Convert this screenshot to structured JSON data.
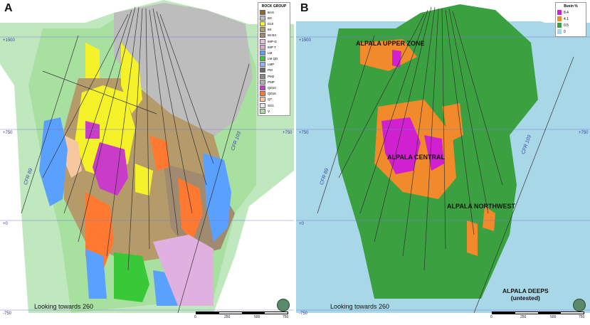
{
  "panel_a": {
    "label": "A",
    "legend_title": "ROCK GROUP",
    "legend": [
      {
        "code": "BAS",
        "color": "#8a6a2a"
      },
      {
        "code": "BX",
        "color": "#bdbdbd"
      },
      {
        "code": "D10",
        "color": "#f5f22a"
      },
      {
        "code": "IM",
        "color": "#b59a6a"
      },
      {
        "code": "IM BX",
        "color": "#a08a70"
      },
      {
        "code": "IMP-D",
        "color": "#e8c0e0"
      },
      {
        "code": "IMP T",
        "color": "#d8a8d0"
      },
      {
        "code": "LM",
        "color": "#5aa0ff"
      },
      {
        "code": "LM QD",
        "color": "#38c838"
      },
      {
        "code": "LMP",
        "color": "#9ab0ff"
      },
      {
        "code": "PM",
        "color": "#6a6a6a"
      },
      {
        "code": "PM2",
        "color": "#888888"
      },
      {
        "code": "PMP",
        "color": "#b0b0b0"
      },
      {
        "code": "QD10",
        "color": "#c83cc8"
      },
      {
        "code": "QD15",
        "color": "#ff7a30"
      },
      {
        "code": "QT",
        "color": "#f7c8a0"
      },
      {
        "code": "SG1",
        "color": "#e6e6e6"
      },
      {
        "code": "V",
        "color": "#a8e0a0"
      }
    ],
    "elevations": [
      "+1500",
      "+750",
      "+0",
      "-750"
    ],
    "elevations_right": [
      "+750"
    ],
    "drillholes": [
      "CFR 69",
      "CFR 103"
    ],
    "looking": "Looking towards 260",
    "scale_ticks": [
      "0",
      "250",
      "500",
      "750"
    ]
  },
  "panel_b": {
    "label": "B",
    "legend_title": "Bvein %",
    "legend": [
      {
        "value": "8.4",
        "color": "#d020d0"
      },
      {
        "value": "4.1",
        "color": "#f08a2a"
      },
      {
        "value": "0.5",
        "color": "#3aa040"
      },
      {
        "value": "0",
        "color": "#a8d8e8"
      }
    ],
    "zones": [
      "ALPALA UPPER ZONE",
      "ALPALA CENTRAL",
      "ALPALA NORTHWEST"
    ],
    "deeps_line1": "ALPALA DEEPS",
    "deeps_line2": "(untested)",
    "elevations": [
      "+1500",
      "+750",
      "+0",
      "-750"
    ],
    "elevations_right": [
      "+750"
    ],
    "drillholes": [
      "CFR 69",
      "CFR 103"
    ],
    "looking": "Looking towards 260",
    "scale_ticks": [
      "0",
      "250",
      "500",
      "750"
    ]
  }
}
